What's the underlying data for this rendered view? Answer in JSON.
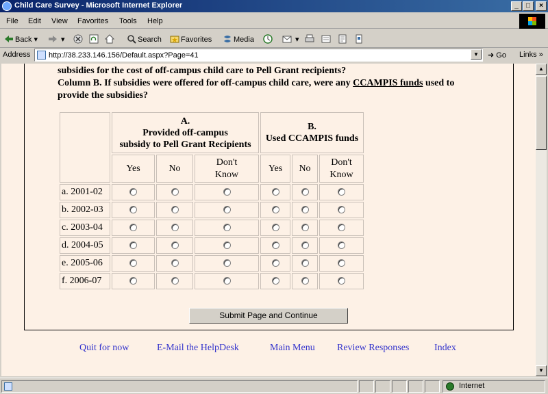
{
  "window": {
    "title": "Child Care Survey - Microsoft Internet Explorer",
    "buttons": {
      "minimize": "_",
      "maximize": "□",
      "close": "×"
    }
  },
  "menu": [
    "File",
    "Edit",
    "View",
    "Favorites",
    "Tools",
    "Help"
  ],
  "toolbar": {
    "back": "Back",
    "search": "Search",
    "favorites": "Favorites",
    "media": "Media"
  },
  "address": {
    "label": "Address",
    "url": "http://38.233.146.156/Default.aspx?Page=41",
    "go": "Go",
    "links": "Links"
  },
  "question": {
    "line1": "subsidies for the cost of off-campus child care to Pell Grant recipients?",
    "line2_pre": "Column B. If subsidies were offered for off-campus child care, were any ",
    "line2_link": "CCAMPIS funds",
    "line2_post": " used to",
    "line3": "provide the subsidies?"
  },
  "table": {
    "col_a": {
      "letter": "A.",
      "line1": "Provided off-campus",
      "line2": "subsidy to Pell Grant Recipients"
    },
    "col_b": {
      "letter": "B.",
      "line1": "Used CCAMPIS funds"
    },
    "options": {
      "yes": "Yes",
      "no": "No",
      "dk1": "Don't",
      "dk2": "Know"
    },
    "rows": [
      "a. 2001-02",
      "b. 2002-03",
      "c. 2003-04",
      "d. 2004-05",
      "e. 2005-06",
      "f. 2006-07"
    ]
  },
  "submit_label": "Submit Page and Continue",
  "footer_links": {
    "quit": "Quit for now",
    "email": "E-Mail the HelpDesk",
    "main": "Main Menu",
    "review": "Review Responses",
    "index": "Index"
  },
  "status": {
    "zone": "Internet"
  }
}
